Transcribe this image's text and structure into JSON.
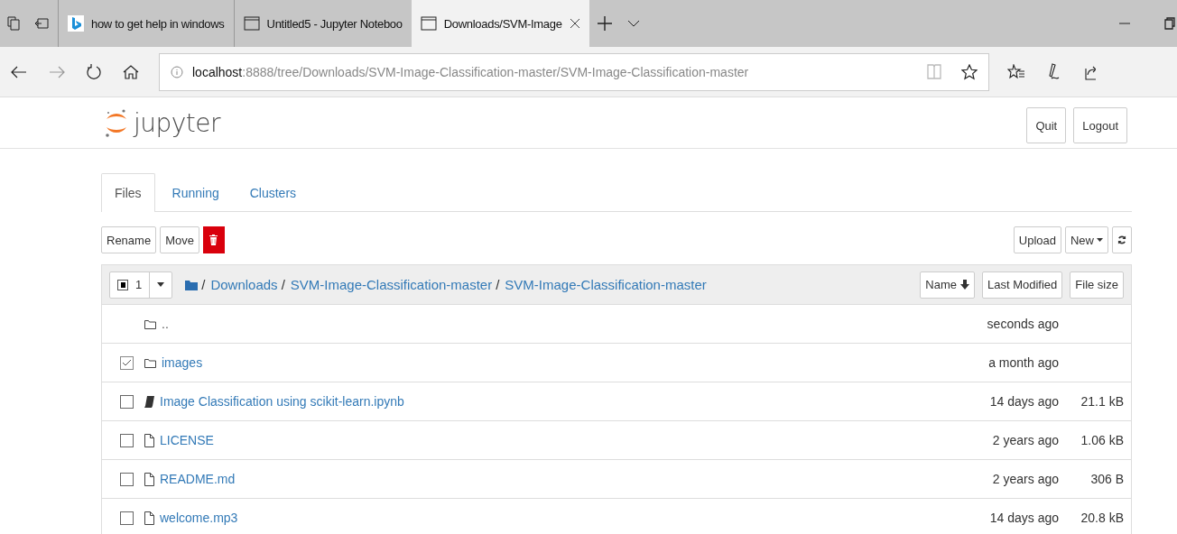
{
  "browser_tabs": [
    {
      "label": "how to get help in windows",
      "kind": "bing",
      "selected": false
    },
    {
      "label": "Untitled5 - Jupyter Noteboo",
      "kind": "page",
      "selected": false
    },
    {
      "label": "Downloads/SVM-Image",
      "kind": "page",
      "selected": true
    }
  ],
  "address_bar": {
    "host": "localhost",
    "path": ":8888/tree/Downloads/SVM-Image-Classification-master/SVM-Image-Classification-master"
  },
  "header": {
    "logo_text": "jupyter",
    "buttons": [
      "Quit",
      "Logout"
    ]
  },
  "tabs": [
    {
      "label": "Files",
      "selected": true
    },
    {
      "label": "Running",
      "selected": false
    },
    {
      "label": "Clusters",
      "selected": false
    }
  ],
  "actions": [
    "Rename",
    "Move"
  ],
  "right_actions": {
    "upload": "Upload",
    "new": "New"
  },
  "list_header": {
    "selected_count": "1",
    "select_partial": true,
    "separator": "/",
    "breadcrumb": [
      "Downloads",
      "SVM-Image-Classification-master",
      "SVM-Image-Classification-master"
    ],
    "sort_buttons": [
      {
        "label": "Name",
        "sorted": true
      },
      {
        "label": "Last Modified",
        "sorted": false
      },
      {
        "label": "File size",
        "sorted": false
      }
    ]
  },
  "rows": [
    {
      "kind": "up",
      "name": "..",
      "modified": "seconds ago"
    },
    {
      "kind": "folder",
      "name": "images",
      "modified": "a month ago",
      "checked": true
    },
    {
      "kind": "notebook",
      "name": "Image Classification using scikit-learn.ipynb",
      "modified": "14 days ago",
      "size": "21.1 kB",
      "checked": false
    },
    {
      "kind": "file",
      "name": "LICENSE",
      "modified": "2 years ago",
      "size": "1.06 kB",
      "checked": false
    },
    {
      "kind": "file",
      "name": "README.md",
      "modified": "2 years ago",
      "size": "306 B",
      "checked": false
    },
    {
      "kind": "file",
      "name": "welcome.mp3",
      "modified": "14 days ago",
      "size": "20.8 kB",
      "checked": false
    }
  ]
}
